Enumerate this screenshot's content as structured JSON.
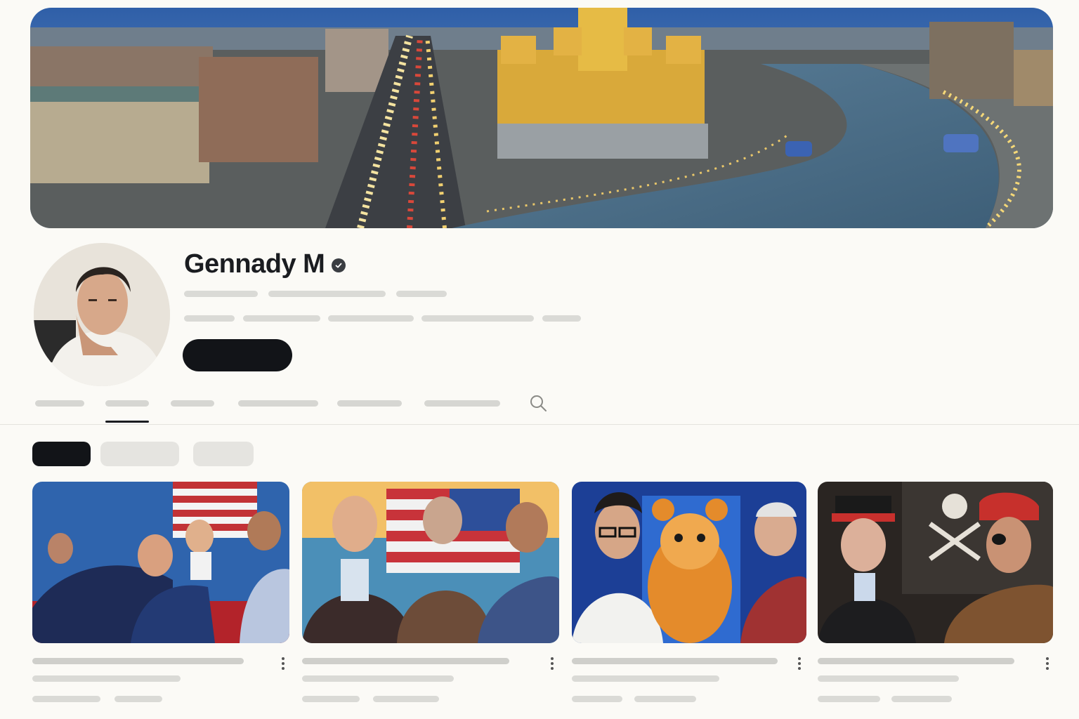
{
  "channel": {
    "name": "Gennady M",
    "verified": true
  },
  "colors": {
    "accent_dark": "#121418",
    "placeholder": "#dadad6",
    "chip_inactive": "#e5e4e0"
  },
  "icons": {
    "verified": "verified-check-icon",
    "search": "search-icon",
    "more": "more-vert-icon"
  },
  "videos": [
    {
      "thumbnail": "rally-scene-with-flag"
    },
    {
      "thumbnail": "three-men-with-us-flag"
    },
    {
      "thumbnail": "hamster-mascot-between-two-men"
    },
    {
      "thumbnail": "pirate-themed-portraits"
    }
  ]
}
